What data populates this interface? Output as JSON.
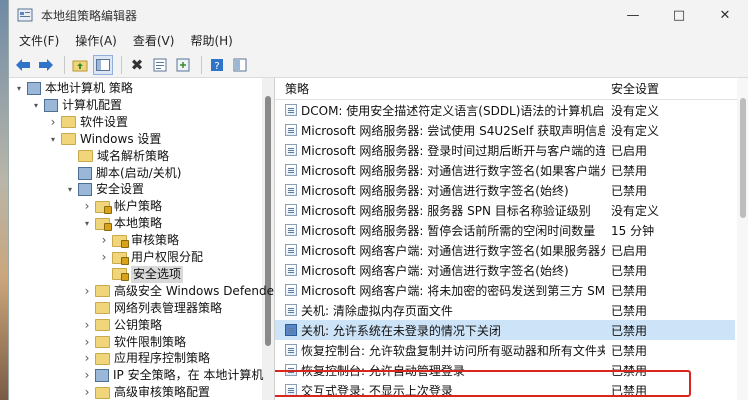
{
  "window": {
    "title": "本地组策略编辑器"
  },
  "menu": [
    "文件(F)",
    "操作(A)",
    "查看(V)",
    "帮助(H)"
  ],
  "icons": {
    "app": "group-policy-icon",
    "back": "back-arrow-icon",
    "forward": "forward-arrow-icon",
    "up": "up-folder-icon",
    "show_hide": "show-hide-tree-icon",
    "delete": "delete-x-icon",
    "properties": "properties-icon",
    "export": "export-list-icon",
    "help": "help-icon",
    "extended": "extended-view-icon"
  },
  "tree": [
    {
      "label": "本地计算机 策略",
      "indent": 0,
      "twisty": "down",
      "icon": "node"
    },
    {
      "label": "计算机配置",
      "indent": 1,
      "twisty": "down",
      "icon": "node"
    },
    {
      "label": "软件设置",
      "indent": 2,
      "twisty": "right",
      "icon": "folder"
    },
    {
      "label": "Windows 设置",
      "indent": 2,
      "twisty": "down",
      "icon": "folder"
    },
    {
      "label": "域名解析策略",
      "indent": 3,
      "twisty": "",
      "icon": "folder"
    },
    {
      "label": "脚本(启动/关机)",
      "indent": 3,
      "twisty": "",
      "icon": "node"
    },
    {
      "label": "安全设置",
      "indent": 3,
      "twisty": "down",
      "icon": "node"
    },
    {
      "label": "帐户策略",
      "indent": 4,
      "twisty": "right",
      "icon": "lock"
    },
    {
      "label": "本地策略",
      "indent": 4,
      "twisty": "down",
      "icon": "lock"
    },
    {
      "label": "审核策略",
      "indent": 5,
      "twisty": "right",
      "icon": "lock"
    },
    {
      "label": "用户权限分配",
      "indent": 5,
      "twisty": "right",
      "icon": "lock"
    },
    {
      "label": "安全选项",
      "indent": 5,
      "twisty": "",
      "icon": "lock",
      "selected": true
    },
    {
      "label": "高级安全 Windows Defender 防",
      "indent": 4,
      "twisty": "right",
      "icon": "folder"
    },
    {
      "label": "网络列表管理器策略",
      "indent": 4,
      "twisty": "",
      "icon": "folder"
    },
    {
      "label": "公钥策略",
      "indent": 4,
      "twisty": "right",
      "icon": "folder"
    },
    {
      "label": "软件限制策略",
      "indent": 4,
      "twisty": "right",
      "icon": "folder"
    },
    {
      "label": "应用程序控制策略",
      "indent": 4,
      "twisty": "right",
      "icon": "folder"
    },
    {
      "label": "IP 安全策略，在 本地计算机",
      "indent": 4,
      "twisty": "right",
      "icon": "node"
    },
    {
      "label": "高级审核策略配置",
      "indent": 4,
      "twisty": "right",
      "icon": "folder"
    }
  ],
  "list": {
    "col_policy": "策略",
    "col_setting": "安全设置",
    "rows": [
      {
        "policy": "DCOM: 使用安全描述符定义语言(SDDL)语法的计算机启动...",
        "setting": "没有定义"
      },
      {
        "policy": "Microsoft 网络服务器: 尝试使用 S4U2Self 获取声明信息",
        "setting": "没有定义"
      },
      {
        "policy": "Microsoft 网络服务器: 登录时间过期后断开与客户端的连接",
        "setting": "已启用"
      },
      {
        "policy": "Microsoft 网络服务器: 对通信进行数字签名(如果客户端允许)",
        "setting": "已禁用"
      },
      {
        "policy": "Microsoft 网络服务器: 对通信进行数字签名(始终)",
        "setting": "已禁用"
      },
      {
        "policy": "Microsoft 网络服务器: 服务器 SPN 目标名称验证级别",
        "setting": "没有定义"
      },
      {
        "policy": "Microsoft 网络服务器: 暂停会话前所需的空闲时间数量",
        "setting": "15 分钟"
      },
      {
        "policy": "Microsoft 网络客户端: 对通信进行数字签名(如果服务器允许)",
        "setting": "已启用"
      },
      {
        "policy": "Microsoft 网络客户端: 对通信进行数字签名(始终)",
        "setting": "已禁用"
      },
      {
        "policy": "Microsoft 网络客户端: 将未加密的密码发送到第三方 SMB ...",
        "setting": "已禁用"
      },
      {
        "policy": "关机: 清除虚拟内存页面文件",
        "setting": "已禁用"
      },
      {
        "policy": "关机: 允许系统在未登录的情况下关闭",
        "setting": "已禁用",
        "selected": true
      },
      {
        "policy": "恢复控制台: 允许软盘复制并访问所有驱动器和所有文件夹",
        "setting": "已禁用"
      },
      {
        "policy": "恢复控制台: 允许自动管理登录",
        "setting": "已禁用"
      },
      {
        "policy": "交互式登录: 不显示上次登录",
        "setting": "已禁用"
      }
    ]
  }
}
